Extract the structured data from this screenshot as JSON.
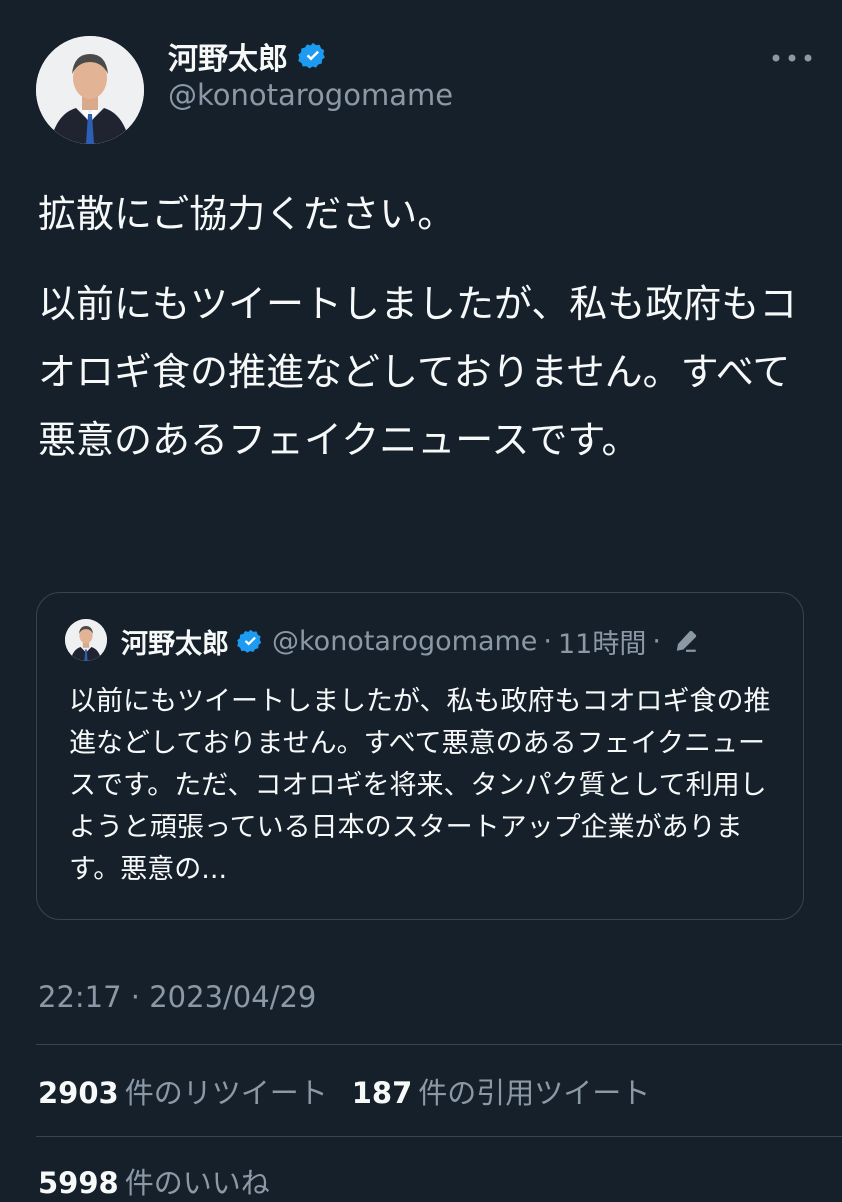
{
  "author": {
    "name": "河野太郎",
    "handle": "@konotarogomame",
    "verified_color": "#1d9bf0"
  },
  "tweet": {
    "paragraph1": "拡散にご協力ください。",
    "paragraph2": "以前にもツイートしましたが、私も政府もコオロギ食の推進などしておりません。すべて悪意のあるフェイクニュースです。",
    "timestamp": "22:17 · 2023/04/29"
  },
  "quote": {
    "name": "河野太郎",
    "handle": "@konotarogomame",
    "separator": "·",
    "time": "11時間",
    "text": "以前にもツイートしましたが、私も政府もコオロギ食の推進などしておりません。すべて悪意のあるフェイクニュースです。ただ、コオロギを将来、タンパク質として利用しようと頑張っている日本のスタートアップ企業があります。悪意の..."
  },
  "stats": {
    "retweets_count": "2903",
    "retweets_label": "件のリツイート",
    "quotes_count": "187",
    "quotes_label": "件の引用ツイート",
    "likes_count": "5998",
    "likes_label": "件のいいね"
  },
  "icons": {
    "verified": "verified-badge-icon",
    "more": "more-options-icon",
    "edit": "edit-pencil-icon"
  },
  "colors": {
    "background": "#15202b",
    "text": "#f7f9f9",
    "secondary": "#8b98a5",
    "border": "#38444d",
    "accent": "#1d9bf0"
  }
}
